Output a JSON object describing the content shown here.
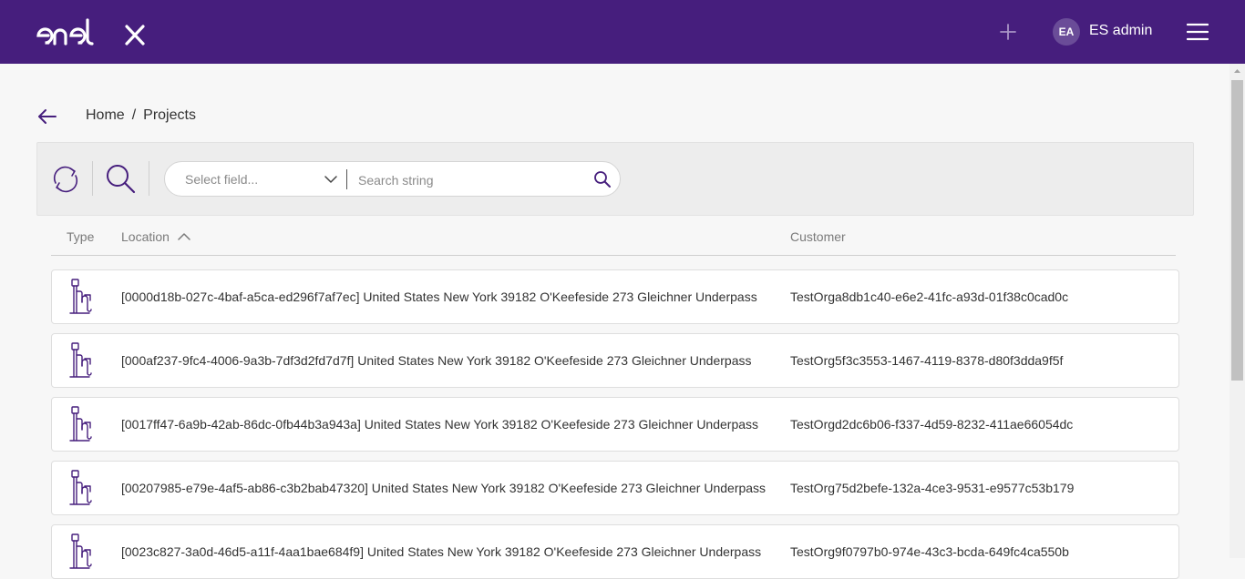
{
  "header": {
    "logo_text": "enel x",
    "user_initials": "EA",
    "user_name": "ES admin",
    "brand_color": "#461e7d"
  },
  "breadcrumb": {
    "home": "Home",
    "separator": "/",
    "current": "Projects"
  },
  "search": {
    "field_placeholder": "Select field...",
    "string_placeholder": "Search string"
  },
  "table": {
    "columns": [
      "Type",
      "Location",
      "Customer"
    ],
    "sorted_by": "Location",
    "sort_direction": "ascending",
    "rows": [
      {
        "type_icon": "charging-station-icon",
        "location": "[0000d18b-027c-4baf-a5ca-ed296f7af7ec] United States New York 39182 O'Keefeside 273 Gleichner Underpass",
        "customer": "TestOrga8db1c40-e6e2-41fc-a93d-01f38c0cad0c"
      },
      {
        "type_icon": "charging-station-icon",
        "location": "[000af237-9fc4-4006-9a3b-7df3d2fd7d7f] United States New York 39182 O'Keefeside 273 Gleichner Underpass",
        "customer": "TestOrg5f3c3553-1467-4119-8378-d80f3dda9f5f"
      },
      {
        "type_icon": "charging-station-icon",
        "location": "[0017ff47-6a9b-42ab-86dc-0fb44b3a943a] United States New York 39182 O'Keefeside 273 Gleichner Underpass",
        "customer": "TestOrgd2dc6b06-f337-4d59-8232-411ae66054dc"
      },
      {
        "type_icon": "charging-station-icon",
        "location": "[00207985-e79e-4af5-ab86-c3b2bab47320] United States New York 39182 O'Keefeside 273 Gleichner Underpass",
        "customer": "TestOrg75d2befe-132a-4ce3-9531-e9577c53b179"
      },
      {
        "type_icon": "charging-station-icon",
        "location": "[0023c827-3a0d-46d5-a11f-4aa1bae684f9] United States New York 39182 O'Keefeside 273 Gleichner Underpass",
        "customer": "TestOrg9f0797b0-974e-43c3-bcda-649fc4ca550b"
      }
    ]
  }
}
